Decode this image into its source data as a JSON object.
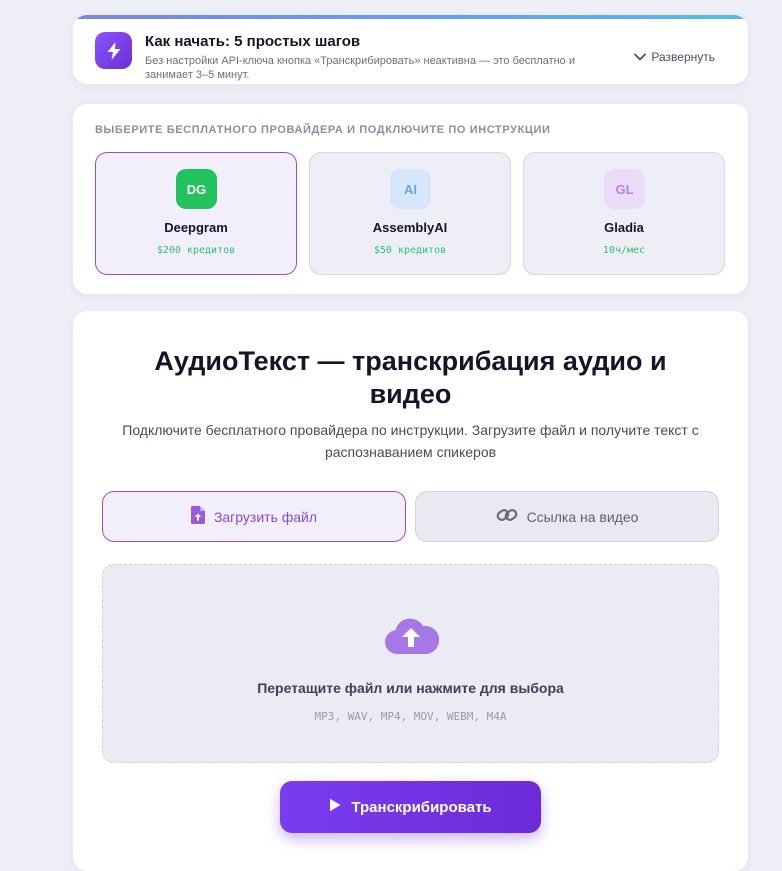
{
  "banner": {
    "title": "Как начать: 5 простых шагов",
    "subtitle": "Без настройки API-ключа кнопка «Транскрибировать» неактивна — это бесплатно и занимает 3–5 минут.",
    "expand_label": "Развернуть",
    "icon": "lightning-icon"
  },
  "providers": {
    "heading": "Выберите бесплатного провайдера и подключите по инструкции",
    "items": [
      {
        "badge": "DG",
        "name": "Deepgram",
        "credit": "$200 кредитов",
        "selected": true,
        "badge_bg": "#22c35d",
        "badge_fg": "#ffffff"
      },
      {
        "badge": "AI",
        "name": "AssemblyAI",
        "credit": "$50 кредитов",
        "selected": false,
        "badge_bg": "#d6e6fb",
        "badge_fg": "#6aa4ea"
      },
      {
        "badge": "GL",
        "name": "Gladia",
        "credit": "10ч/мес",
        "selected": false,
        "badge_bg": "#eadcf6",
        "badge_fg": "#b97ee6"
      }
    ]
  },
  "main": {
    "title": "АудиоТекст — транскрибация аудио и видео",
    "subtitle": "Подключите бесплатного провайдера по инструкции. Загрузите файл и получите текст с распознаванием спикеров",
    "tabs": [
      {
        "label": "Загрузить файл",
        "icon": "file-upload-icon",
        "active": true
      },
      {
        "label": "Ссылка на видео",
        "icon": "link-icon",
        "active": false
      }
    ],
    "dropzone": {
      "title": "Перетащите файл или нажмите для выбора",
      "formats": "MP3, WAV, MP4, MOV, WEBM, M4A",
      "icon": "cloud-upload-icon"
    },
    "submit_label": "Транскрибировать",
    "submit_icon": "play-icon"
  },
  "colors": {
    "accent": "#7b3cf0",
    "selected_border": "#9a4fc9",
    "credit_green": "#2fbf74",
    "page_bg": "#eeeef7"
  }
}
